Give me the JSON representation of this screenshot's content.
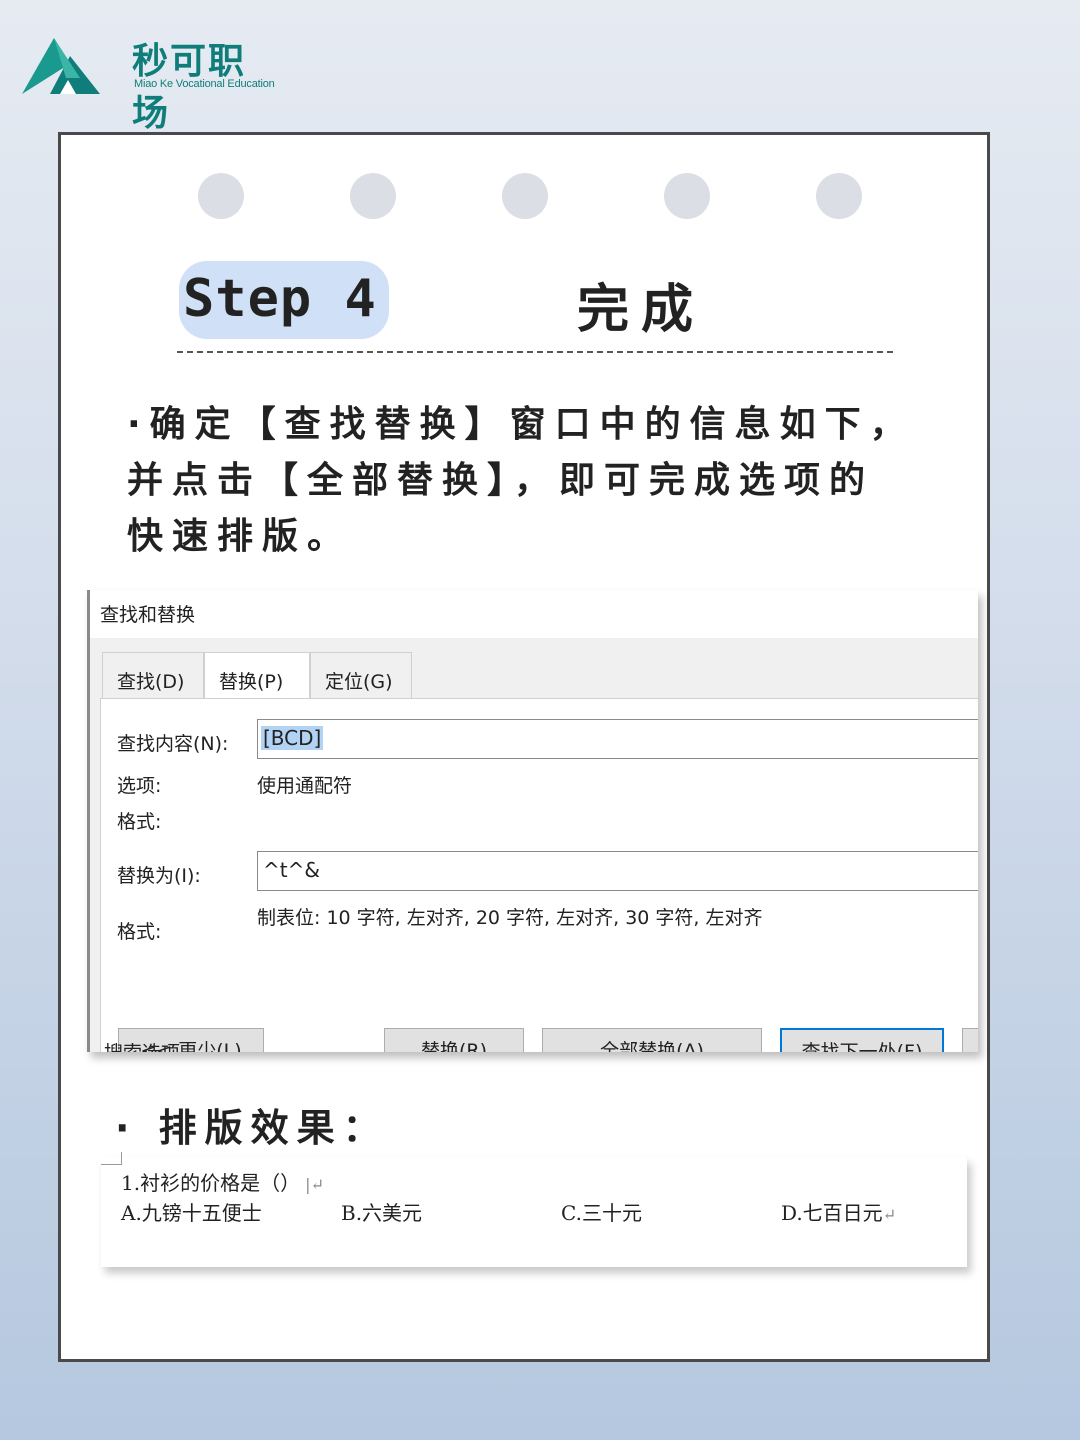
{
  "brand": {
    "name": "秒可职场",
    "subtitle": "Miao Ke Vocational Education"
  },
  "header": {
    "step_label": "Step 4",
    "title": "完成"
  },
  "instruction": "·确定【查找替换】窗口中的信息如下，并点击【全部替换】，即可完成选项的快速排版。",
  "dialog": {
    "title": "查找和替换",
    "tabs": [
      "查找(D)",
      "替换(P)",
      "定位(G)"
    ],
    "active_tab": "替换(P)",
    "find_label": "查找内容(N):",
    "find_value": "[BCD]",
    "options_label": "选项:",
    "options_value": "使用通配符",
    "format_label_1": "格式:",
    "replace_label": "替换为(I):",
    "replace_value": "^t^&",
    "format_label_2": "格式:",
    "format_value": "制表位: 10 字符, 左对齐, 20 字符, 左对齐, 30 字符, 左对齐",
    "buttons": {
      "less": "<< 更少(L)",
      "replace": "替换(R)",
      "replace_all": "全部替换(A)",
      "find_next": "查找下一处(F)"
    },
    "search_options_label": "搜索选项"
  },
  "effect_heading": "· 排版效果：",
  "result": {
    "question": "1.衬衫的价格是（）",
    "options": [
      "A.九镑十五便士",
      "B.六美元",
      "C.三十元",
      "D.七百日元"
    ]
  },
  "colors": {
    "brand": "#0f7d7a",
    "step_badge": "#cfe0f7",
    "selection": "#b3d3f5",
    "focus_border": "#0078d7"
  }
}
